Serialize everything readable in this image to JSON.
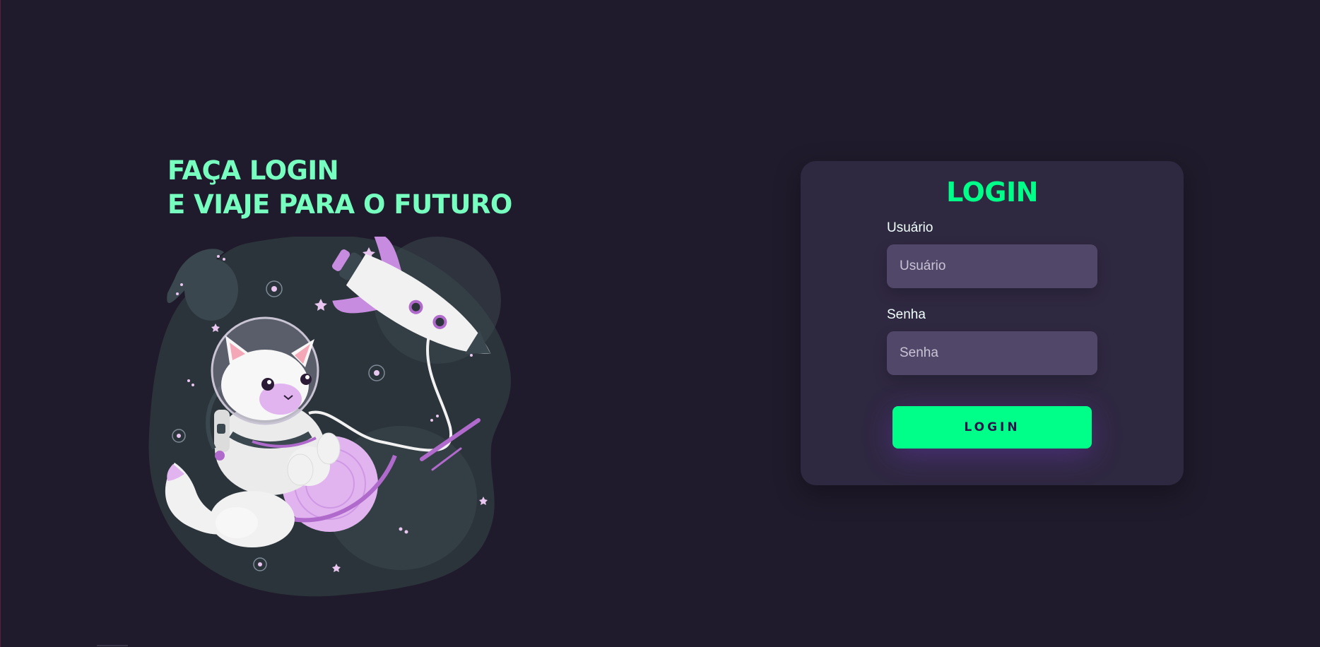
{
  "hero": {
    "headline_line1": "FAÇA LOGIN",
    "headline_line2": "E VIAJE PARA O FUTURO",
    "illustration": "astronaut-cat-with-rocket"
  },
  "login_card": {
    "title": "LOGIN",
    "username": {
      "label": "Usuário",
      "placeholder": "Usuário",
      "value": ""
    },
    "password": {
      "label": "Senha",
      "placeholder": "Senha",
      "value": ""
    },
    "submit_label": "LOGIN"
  },
  "colors": {
    "background": "#201b2c",
    "card": "#2f2841",
    "input": "#514869",
    "accent": "#00ff88",
    "headline": "#77ffc0"
  }
}
